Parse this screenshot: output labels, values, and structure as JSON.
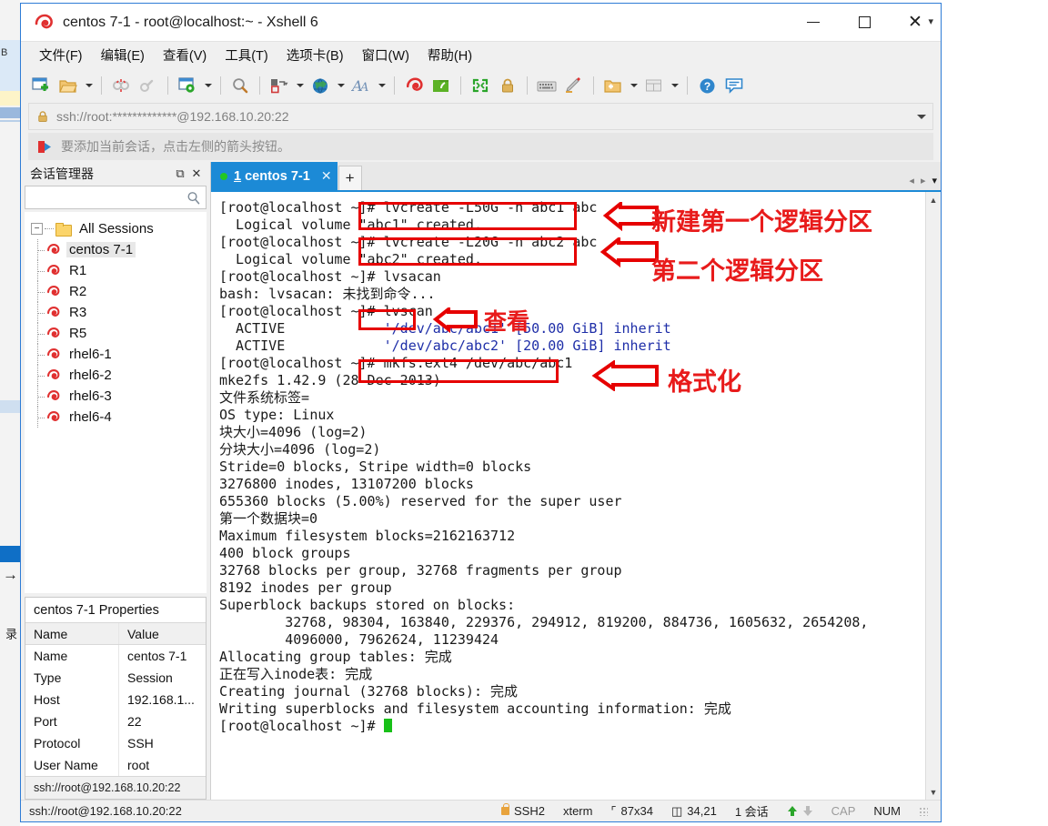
{
  "window": {
    "title": "centos 7-1 - root@localhost:~ - Xshell 6",
    "app_icon": "xshell-icon",
    "minimize_label": "—",
    "maximize_label": "☐",
    "close_label": "✕"
  },
  "menubar": [
    {
      "label": "文件(F)",
      "name": "menu-file"
    },
    {
      "label": "编辑(E)",
      "name": "menu-edit"
    },
    {
      "label": "查看(V)",
      "name": "menu-view"
    },
    {
      "label": "工具(T)",
      "name": "menu-tools"
    },
    {
      "label": "选项卡(B)",
      "name": "menu-tabs"
    },
    {
      "label": "窗口(W)",
      "name": "menu-window"
    },
    {
      "label": "帮助(H)",
      "name": "menu-help"
    }
  ],
  "toolbar": {
    "overflow_label": "▾",
    "icons": [
      "new-session-icon",
      "open-folder-icon",
      "disconnect-icon",
      "link-icon",
      "session-properties-icon",
      "find-icon",
      "transfer-icon",
      "browser-icon",
      "font-icon",
      "xshell-icon",
      "xftp-icon",
      "fullscreen-icon",
      "lock-icon",
      "keyboard-icon",
      "highlight-pen-icon",
      "add-to-folder-icon",
      "layout-icon",
      "help-icon",
      "feedback-icon"
    ]
  },
  "urlbar": {
    "icon": "lock-icon",
    "value": "ssh://root:*************@192.168.10.20:22",
    "dropdown": "chevron-down-icon"
  },
  "hintbar": {
    "icon": "red-arrow-icon",
    "text": "要添加当前会话，点击左侧的箭头按钮。"
  },
  "session_manager": {
    "title": "会话管理器",
    "pin_label": "⧉",
    "close_label": "✕",
    "search_placeholder": "",
    "search_value": "",
    "search_icon": "search-icon",
    "root": {
      "label": "All Sessions",
      "expander": "−"
    },
    "items": [
      {
        "label": "centos 7-1",
        "selected": true
      },
      {
        "label": "R1",
        "selected": false
      },
      {
        "label": "R2",
        "selected": false
      },
      {
        "label": "R3",
        "selected": false
      },
      {
        "label": "R5",
        "selected": false
      },
      {
        "label": "rhel6-1",
        "selected": false
      },
      {
        "label": "rhel6-2",
        "selected": false
      },
      {
        "label": "rhel6-3",
        "selected": false
      },
      {
        "label": "rhel6-4",
        "selected": false
      }
    ]
  },
  "properties": {
    "title": "centos 7-1 Properties",
    "headers": [
      "Name",
      "Value"
    ],
    "rows": [
      [
        "Name",
        "centos 7-1"
      ],
      [
        "Type",
        "Session"
      ],
      [
        "Host",
        "192.168.1..."
      ],
      [
        "Port",
        "22"
      ],
      [
        "Protocol",
        "SSH"
      ],
      [
        "User Name",
        "root"
      ]
    ],
    "footer": "ssh://root@192.168.10.20:22"
  },
  "tabs": {
    "active": {
      "num": "1",
      "label": " centos 7-1",
      "close": "✕",
      "status_dot": "connected"
    },
    "add_label": "+",
    "nav_prev": "◂",
    "nav_next": "▸",
    "nav_list": "▾"
  },
  "terminal": {
    "lines": [
      [
        {
          "t": "[root@localhost ~]# lvcreate -L50G -n abc1 abc"
        }
      ],
      [
        {
          "t": "  Logical volume \"abc1\" created."
        }
      ],
      [
        {
          "t": "[root@localhost ~]# lvcreate -L20G -n abc2 abc"
        }
      ],
      [
        {
          "t": "  Logical volume \"abc2\" created."
        }
      ],
      [
        {
          "t": "[root@localhost ~]# lvsacan"
        }
      ],
      [
        {
          "t": "bash: lvsacan: 未找到命令..."
        }
      ],
      [
        {
          "t": "[root@localhost ~]# lvscan"
        }
      ],
      [
        {
          "t": "  ACTIVE            "
        },
        {
          "t": "'/dev/abc/abc1' [50.00 GiB] inherit",
          "c": "blue"
        }
      ],
      [
        {
          "t": "  ACTIVE            "
        },
        {
          "t": "'/dev/abc/abc2' [20.00 GiB] inherit",
          "c": "blue"
        }
      ],
      [
        {
          "t": "[root@localhost ~]# mkfs.ext4 /dev/abc/abc1"
        }
      ],
      [
        {
          "t": "mke2fs 1.42.9 (28-Dec-2013)"
        }
      ],
      [
        {
          "t": "文件系统标签="
        }
      ],
      [
        {
          "t": "OS type: Linux"
        }
      ],
      [
        {
          "t": "块大小=4096 (log=2)"
        }
      ],
      [
        {
          "t": "分块大小=4096 (log=2)"
        }
      ],
      [
        {
          "t": "Stride=0 blocks, Stripe width=0 blocks"
        }
      ],
      [
        {
          "t": "3276800 inodes, 13107200 blocks"
        }
      ],
      [
        {
          "t": "655360 blocks (5.00%) reserved for the super user"
        }
      ],
      [
        {
          "t": "第一个数据块=0"
        }
      ],
      [
        {
          "t": "Maximum filesystem blocks=2162163712"
        }
      ],
      [
        {
          "t": "400 block groups"
        }
      ],
      [
        {
          "t": "32768 blocks per group, 32768 fragments per group"
        }
      ],
      [
        {
          "t": "8192 inodes per group"
        }
      ],
      [
        {
          "t": "Superblock backups stored on blocks:"
        }
      ],
      [
        {
          "t": "        32768, 98304, 163840, 229376, 294912, 819200, 884736, 1605632, 2654208,"
        }
      ],
      [
        {
          "t": "        4096000, 7962624, 11239424"
        }
      ],
      [
        {
          "t": ""
        }
      ],
      [
        {
          "t": "Allocating group tables: 完成"
        }
      ],
      [
        {
          "t": "正在写入inode表: 完成"
        }
      ],
      [
        {
          "t": "Creating journal (32768 blocks): 完成"
        }
      ],
      [
        {
          "t": "Writing superblocks and filesystem accounting information: 完成"
        }
      ],
      [
        {
          "t": ""
        }
      ],
      [
        {
          "t": "[root@localhost ~]# "
        },
        {
          "t": "",
          "cursor": true
        }
      ]
    ]
  },
  "annotations": {
    "color": "#e81b1b",
    "notes": [
      {
        "text": "新建第一个逻辑分区",
        "name": "annotation-create-first-lv"
      },
      {
        "text": "第二个逻辑分区",
        "name": "annotation-second-lv"
      },
      {
        "text": "查看",
        "name": "annotation-view"
      },
      {
        "text": "格式化",
        "name": "annotation-format"
      }
    ]
  },
  "statusbar": {
    "left": "ssh://root@192.168.10.20:22",
    "security": "SSH2",
    "terminal_type": "xterm",
    "size": "87x34",
    "cursor": "34,21",
    "sessions": "1 会话",
    "cap": "CAP",
    "num": "NUM"
  },
  "background_window": {
    "fragments": [
      "B",
      "↑",
      "录"
    ]
  }
}
